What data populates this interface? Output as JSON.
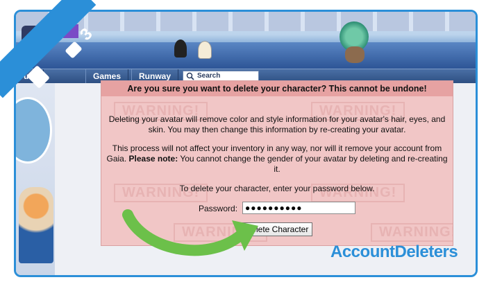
{
  "nav": {
    "tabs": [
      {
        "label": "um"
      },
      {
        "label": "Games"
      },
      {
        "label": "Runway"
      }
    ],
    "search_placeholder": "Search"
  },
  "badge": {
    "step": "3"
  },
  "dialog": {
    "header": "Are you sure you want to delete your character? This cannot be undone!",
    "watermark": "WARNING!",
    "para1": "Deleting your avatar will remove color and style information for your avatar's hair, eyes, and skin. You may then change this information by re-creating your avatar.",
    "para2_a": "This process will not affect your inventory in any way, nor will it remove your account from Gaia. ",
    "para2_bold": "Please note:",
    "para2_b": " You cannot change the gender of your avatar by deleting and re-creating it.",
    "para3": "To delete your character, enter your password below.",
    "password_label": "Password:",
    "password_value": "●●●●●●●●●●",
    "delete_button": "Delete Character"
  },
  "brand": {
    "part1": "Account",
    "part2": "Deleters"
  },
  "colors": {
    "accent": "#2b8fd8",
    "dialog_bg": "#f1c6c6",
    "dialog_header": "#e6a2a2",
    "arrow": "#6cc04a"
  }
}
